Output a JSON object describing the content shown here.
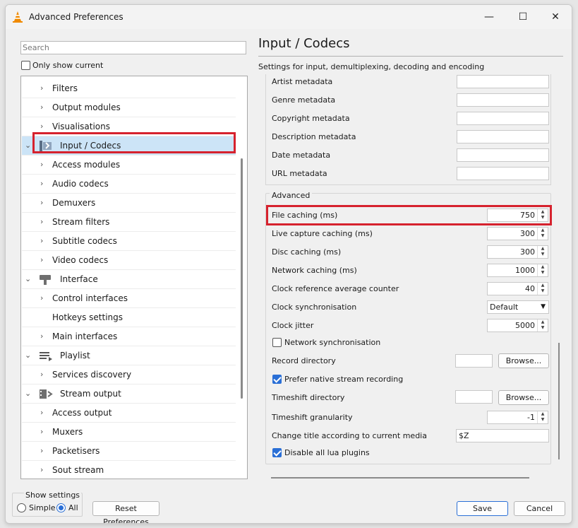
{
  "window": {
    "title": "Advanced Preferences",
    "controls": {
      "minimize": "—",
      "maximize": "☐",
      "close": "✕"
    }
  },
  "sidebar": {
    "search_placeholder": "Search",
    "only_show_current": {
      "label": "Only show current",
      "checked": false
    },
    "tree": [
      {
        "label": "Filters",
        "level": 1,
        "expander": "›"
      },
      {
        "label": "Output modules",
        "level": 1,
        "expander": "›"
      },
      {
        "label": "Visualisations",
        "level": 1,
        "expander": "›"
      },
      {
        "label": "Input / Codecs",
        "level": 0,
        "expander": "⌄",
        "icon": "input-codecs-icon",
        "selected": true
      },
      {
        "label": "Access modules",
        "level": 1,
        "expander": "›"
      },
      {
        "label": "Audio codecs",
        "level": 1,
        "expander": "›"
      },
      {
        "label": "Demuxers",
        "level": 1,
        "expander": "›"
      },
      {
        "label": "Stream filters",
        "level": 1,
        "expander": "›"
      },
      {
        "label": "Subtitle codecs",
        "level": 1,
        "expander": "›"
      },
      {
        "label": "Video codecs",
        "level": 1,
        "expander": "›"
      },
      {
        "label": "Interface",
        "level": 0,
        "expander": "⌄",
        "icon": "interface-icon"
      },
      {
        "label": "Control interfaces",
        "level": 1,
        "expander": "›"
      },
      {
        "label": "Hotkeys settings",
        "level": 1,
        "expander": ""
      },
      {
        "label": "Main interfaces",
        "level": 1,
        "expander": "›"
      },
      {
        "label": "Playlist",
        "level": 0,
        "expander": "⌄",
        "icon": "playlist-icon"
      },
      {
        "label": "Services discovery",
        "level": 1,
        "expander": "›"
      },
      {
        "label": "Stream output",
        "level": 0,
        "expander": "⌄",
        "icon": "stream-output-icon"
      },
      {
        "label": "Access output",
        "level": 1,
        "expander": "›"
      },
      {
        "label": "Muxers",
        "level": 1,
        "expander": "›"
      },
      {
        "label": "Packetisers",
        "level": 1,
        "expander": "›"
      },
      {
        "label": "Sout stream",
        "level": 1,
        "expander": "›"
      }
    ]
  },
  "panel": {
    "title": "Input / Codecs",
    "description": "Settings for input, demultiplexing, decoding and encoding",
    "metadata_fields": [
      {
        "label": "Artist metadata",
        "value": ""
      },
      {
        "label": "Genre metadata",
        "value": ""
      },
      {
        "label": "Copyright metadata",
        "value": ""
      },
      {
        "label": "Description metadata",
        "value": ""
      },
      {
        "label": "Date metadata",
        "value": ""
      },
      {
        "label": "URL metadata",
        "value": ""
      }
    ],
    "advanced": {
      "group_title": "Advanced",
      "file_caching": {
        "label": "File caching (ms)",
        "value": "750"
      },
      "live_capture_caching": {
        "label": "Live capture caching (ms)",
        "value": "300"
      },
      "disc_caching": {
        "label": "Disc caching (ms)",
        "value": "300"
      },
      "network_caching": {
        "label": "Network caching (ms)",
        "value": "1000"
      },
      "clock_reference_avg": {
        "label": "Clock reference average counter",
        "value": "40"
      },
      "clock_sync": {
        "label": "Clock synchronisation",
        "value": "Default"
      },
      "clock_jitter": {
        "label": "Clock jitter",
        "value": "5000"
      },
      "network_sync": {
        "label": "Network synchronisation",
        "checked": false
      },
      "record_directory": {
        "label": "Record directory",
        "value": "",
        "button": "Browse..."
      },
      "prefer_native": {
        "label": "Prefer native stream recording",
        "checked": true
      },
      "timeshift_directory": {
        "label": "Timeshift directory",
        "value": "",
        "button": "Browse..."
      },
      "timeshift_granularity": {
        "label": "Timeshift granularity",
        "value": "-1"
      },
      "change_title": {
        "label": "Change title according to current media",
        "value": "$Z"
      },
      "disable_lua": {
        "label": "Disable all lua plugins",
        "checked": true
      }
    }
  },
  "footer": {
    "show_settings_label": "Show settings",
    "simple_label": "Simple",
    "all_label": "All",
    "selected_mode": "All",
    "reset_label": "Reset Preferences",
    "save_label": "Save",
    "cancel_label": "Cancel"
  },
  "colors": {
    "highlight": "#d6222e",
    "selection": "#cce4f7",
    "accent": "#2a6fd6"
  }
}
